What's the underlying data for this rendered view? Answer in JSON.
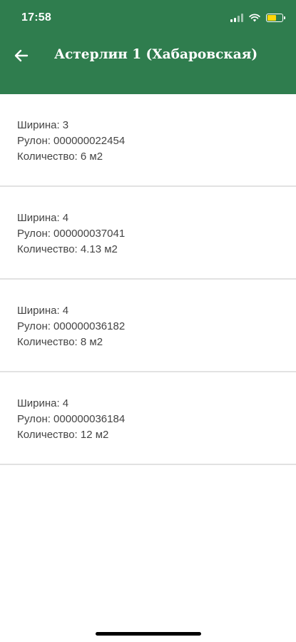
{
  "status_bar": {
    "time": "17:58"
  },
  "nav": {
    "title": "Астерлин 1 (Хабаровская)",
    "back_icon": "arrow-left-icon"
  },
  "colors": {
    "header_bg": "#2f7d4e",
    "battery_fill": "#ffd60a"
  },
  "rolls": [
    {
      "width": "Ширина: 3",
      "roll": "Рулон: 000000022454",
      "quantity": "Количество: 6 м2"
    },
    {
      "width": "Ширина: 4",
      "roll": "Рулон: 000000037041",
      "quantity": "Количество: 4.13 м2"
    },
    {
      "width": "Ширина: 4",
      "roll": "Рулон: 000000036182",
      "quantity": "Количество: 8 м2"
    },
    {
      "width": "Ширина: 4",
      "roll": "Рулон: 000000036184",
      "quantity": "Количество: 12 м2"
    }
  ]
}
